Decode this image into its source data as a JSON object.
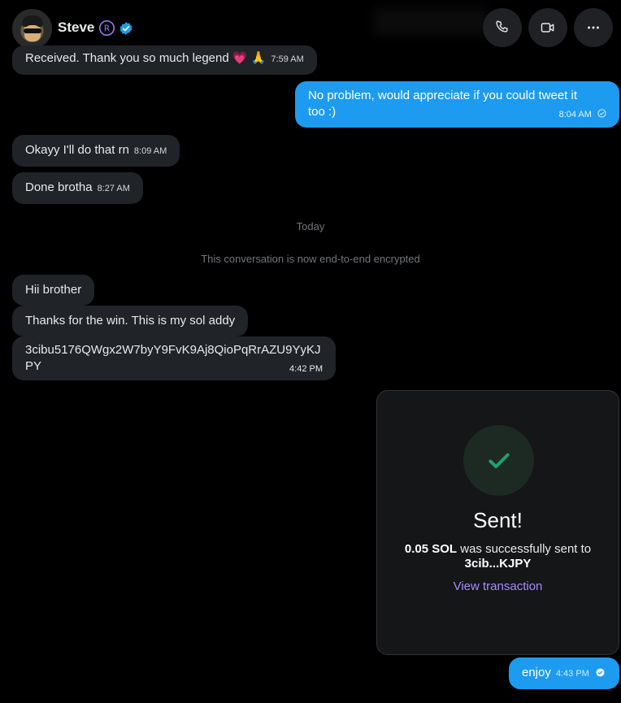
{
  "header": {
    "name": "Steve",
    "icons": [
      "registered-icon",
      "verified-badge-icon",
      "phone-icon",
      "video-icon",
      "more-icon"
    ]
  },
  "messages": [
    {
      "side": "in",
      "text": "Received. Thank you so much legend 💗 🙏",
      "time": "7:59 AM"
    },
    {
      "side": "out",
      "line1": "No problem,  would appreciate if you could tweet it",
      "line2": "too :)",
      "time": "8:04 AM"
    },
    {
      "side": "in",
      "text": "Okayy I'll do that rn",
      "time": "8:09 AM"
    },
    {
      "side": "in",
      "text": "Done brotha",
      "time": "8:27 AM"
    },
    {
      "side": "in",
      "text": "Hii brother"
    },
    {
      "side": "in",
      "text": "Thanks for the win. This is my sol addy"
    },
    {
      "side": "in",
      "line1": "3cibu5176QWgx2W7byY9FvK9Aj8QioPqRrAZU9YyKJ",
      "line2": "PY",
      "time": "4:42 PM"
    },
    {
      "side": "out",
      "text": "enjoy",
      "time": "4:43 PM"
    }
  ],
  "system": {
    "today": "Today",
    "encrypted": "This conversation is now end-to-end encrypted"
  },
  "card": {
    "title": "Sent!",
    "amount": "0.05 SOL",
    "msg_tail": " was successfully sent to",
    "address": "3cib...KJPY",
    "link": "View transaction"
  },
  "colors": {
    "background": "#000000",
    "incoming_bubble": "#202327",
    "outgoing_bubble": "#1d9bf0",
    "accent_purple": "#a78bfa",
    "success_green": "#22a06b"
  }
}
